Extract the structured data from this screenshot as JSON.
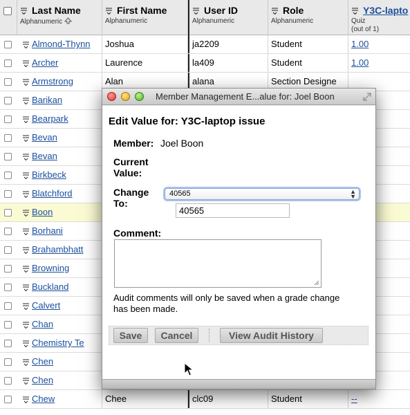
{
  "header": {
    "last_name": {
      "title": "Last Name",
      "sub": "Alphanumeric"
    },
    "first_name": {
      "title": "First Name",
      "sub": "Alphanumeric"
    },
    "user_id": {
      "title": "User ID",
      "sub": "Alphanumeric"
    },
    "role": {
      "title": "Role",
      "sub": "Alphanumeric"
    },
    "y3c": {
      "title": "Y3C-lapto",
      "sub": "Quiz",
      "sub2": "(out of 1)"
    }
  },
  "rows": [
    {
      "last": "Almond-Thynn",
      "first": "Joshua",
      "uid": "ja2209",
      "role": "Student",
      "y3c": "1.00"
    },
    {
      "last": "Archer",
      "first": "Laurence",
      "uid": "la409",
      "role": "Student",
      "y3c": "1.00"
    },
    {
      "last": "Armstrong",
      "first": "Alan",
      "uid": "alana",
      "role": "Section Designe",
      "y3c": ""
    },
    {
      "last": "Barikan",
      "first": "",
      "uid": "",
      "role": "",
      "y3c": ""
    },
    {
      "last": "Bearpark",
      "first": "",
      "uid": "",
      "role": "",
      "y3c": ""
    },
    {
      "last": "Bevan",
      "first": "",
      "uid": "",
      "role": "",
      "y3c": ""
    },
    {
      "last": "Bevan",
      "first": "",
      "uid": "",
      "role": "",
      "y3c": ""
    },
    {
      "last": "Birkbeck",
      "first": "",
      "uid": "",
      "role": "",
      "y3c": ""
    },
    {
      "last": "Blatchford",
      "first": "",
      "uid": "",
      "role": "",
      "y3c": ""
    },
    {
      "last": "Boon",
      "first": "",
      "uid": "",
      "role": "",
      "y3c": ""
    },
    {
      "last": "Borhani",
      "first": "",
      "uid": "",
      "role": "",
      "y3c": ""
    },
    {
      "last": "Brahambhatt",
      "first": "",
      "uid": "",
      "role": "",
      "y3c": ""
    },
    {
      "last": "Browning",
      "first": "",
      "uid": "",
      "role": "",
      "y3c": ""
    },
    {
      "last": "Buckland",
      "first": "",
      "uid": "",
      "role": "",
      "y3c": ""
    },
    {
      "last": "Calvert",
      "first": "",
      "uid": "",
      "role": "",
      "y3c": ""
    },
    {
      "last": "Chan",
      "first": "",
      "uid": "",
      "role": "",
      "y3c": ""
    },
    {
      "last": "Chemistry Te",
      "first": "",
      "uid": "",
      "role": "",
      "y3c": ""
    },
    {
      "last": "Chen",
      "first": "",
      "uid": "",
      "role": "",
      "y3c": ""
    },
    {
      "last": "Chen",
      "first": "",
      "uid": "",
      "role": "",
      "y3c": ""
    },
    {
      "last": "Chew",
      "first": "Chee",
      "uid": "clc09",
      "role": "Student",
      "y3c": "--"
    }
  ],
  "modal": {
    "window_title": "Member Management E...alue for: Joel Boon",
    "heading": "Edit Value for: Y3C-laptop issue",
    "member_label": "Member:",
    "member_value": "Joel Boon",
    "current_label_1": "Current",
    "current_label_2": "Value:",
    "change_label_1": "Change",
    "change_label_2": "To:",
    "select_value": "40565",
    "input_value": "40565",
    "comment_label": "Comment:",
    "note": "Audit comments will only be saved when a grade change has been made.",
    "buttons": {
      "save": "Save",
      "cancel": "Cancel",
      "audit": "View Audit History"
    }
  }
}
